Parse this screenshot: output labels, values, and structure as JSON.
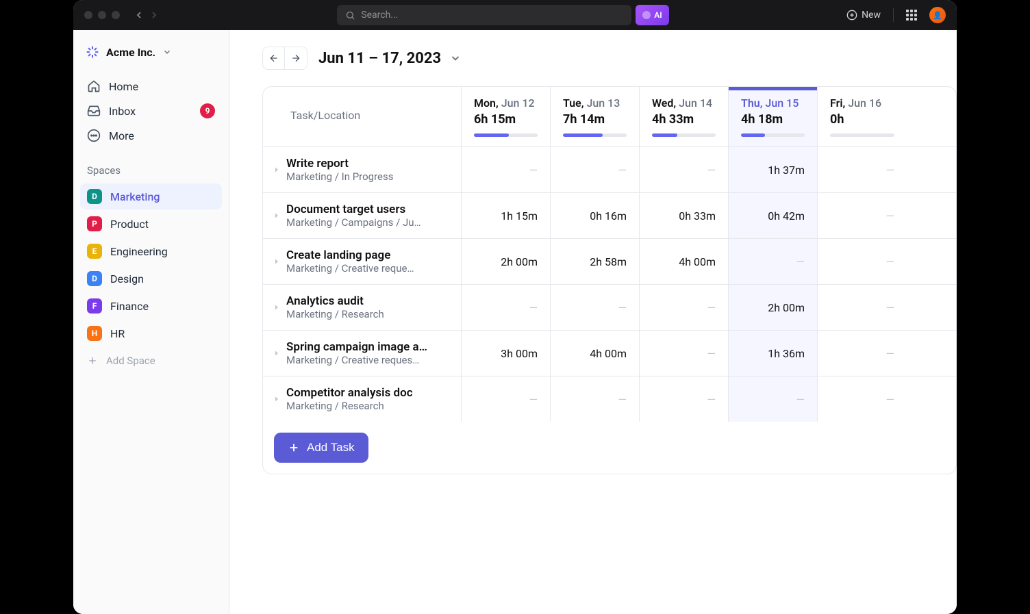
{
  "search_placeholder": "Search...",
  "ai_label": "AI",
  "new_label": "New",
  "workspace": {
    "name": "Acme Inc."
  },
  "nav": {
    "home": "Home",
    "inbox": "Inbox",
    "inbox_badge": "9",
    "more": "More"
  },
  "spaces_label": "Spaces",
  "spaces": [
    {
      "letter": "D",
      "name": "Marketing",
      "color": "#0d9488",
      "active": true
    },
    {
      "letter": "P",
      "name": "Product",
      "color": "#e11d48",
      "active": false
    },
    {
      "letter": "E",
      "name": "Engineering",
      "color": "#eab308",
      "active": false
    },
    {
      "letter": "D",
      "name": "Design",
      "color": "#3b82f6",
      "active": false
    },
    {
      "letter": "F",
      "name": "Finance",
      "color": "#7c3aed",
      "active": false
    },
    {
      "letter": "H",
      "name": "HR",
      "color": "#f97316",
      "active": false
    }
  ],
  "add_space": "Add Space",
  "date_range": "Jun 11 – 17, 2023",
  "task_location_label": "Task/Location",
  "days": [
    {
      "dow": "Mon,",
      "date": "Jun 12",
      "total": "6h 15m",
      "fill": 55,
      "current": false
    },
    {
      "dow": "Tue,",
      "date": "Jun 13",
      "total": "7h 14m",
      "fill": 62,
      "current": false
    },
    {
      "dow": "Wed,",
      "date": "Jun 14",
      "total": "4h 33m",
      "fill": 40,
      "current": false
    },
    {
      "dow": "Thu,",
      "date": "Jun 15",
      "total": "4h 18m",
      "fill": 38,
      "current": true
    },
    {
      "dow": "Fri,",
      "date": "Jun 16",
      "total": "0h",
      "fill": 0,
      "current": false
    }
  ],
  "tasks": [
    {
      "title": "Write report",
      "path": "Marketing / In Progress",
      "cells": [
        "",
        "",
        "",
        "1h  37m",
        ""
      ]
    },
    {
      "title": "Document target users",
      "path": "Marketing / Campaigns / Ju…",
      "cells": [
        "1h 15m",
        "0h 16m",
        "0h 33m",
        "0h 42m",
        ""
      ]
    },
    {
      "title": "Create landing page",
      "path": "Marketing / Creative reque…",
      "cells": [
        "2h 00m",
        "2h 58m",
        "4h 00m",
        "",
        ""
      ]
    },
    {
      "title": "Analytics audit",
      "path": "Marketing / Research",
      "cells": [
        "",
        "",
        "",
        "2h 00m",
        ""
      ]
    },
    {
      "title": "Spring campaign image a…",
      "path": "Marketing / Creative reques…",
      "cells": [
        "3h 00m",
        "4h 00m",
        "",
        "1h 36m",
        ""
      ]
    },
    {
      "title": "Competitor analysis doc",
      "path": "Marketing / Research",
      "cells": [
        "",
        "",
        "",
        "",
        ""
      ]
    }
  ],
  "add_task": "Add Task"
}
